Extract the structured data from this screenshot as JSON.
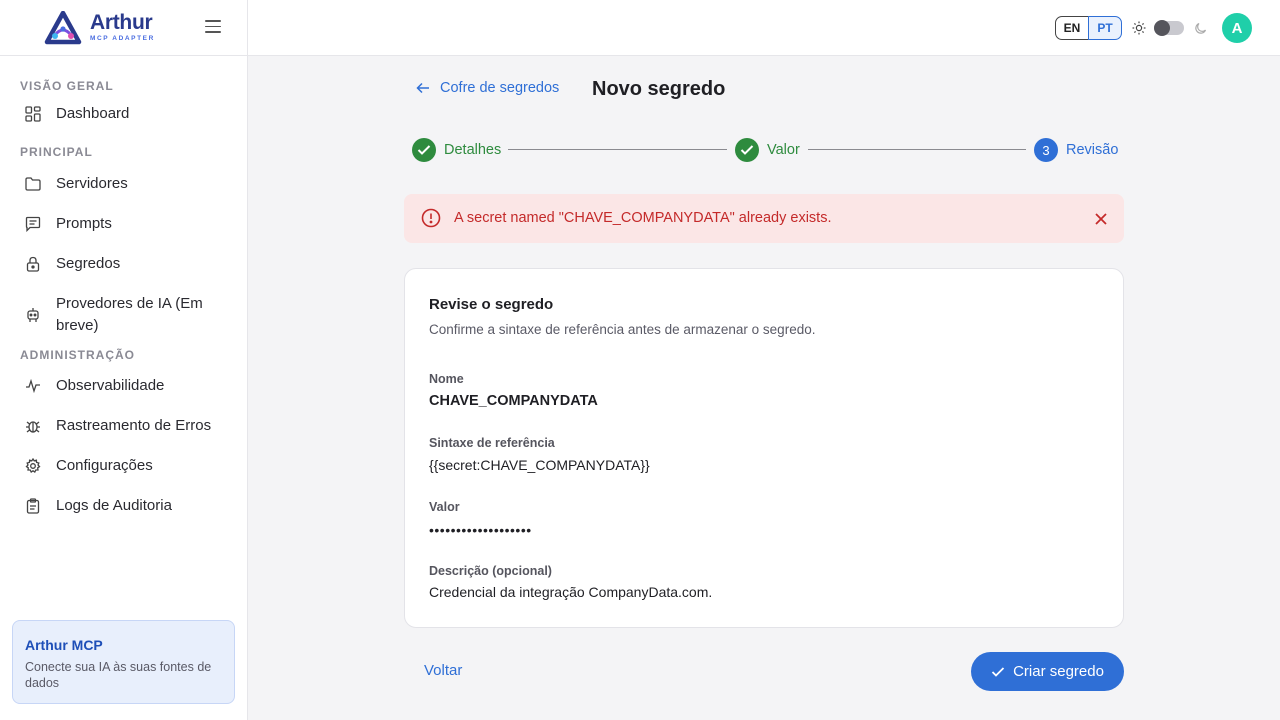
{
  "brand": {
    "name": "Arthur",
    "subtitle": "MCP ADAPTER"
  },
  "sidebar": {
    "sections": [
      {
        "title": "VISÃO GERAL",
        "items": [
          {
            "label": "Dashboard",
            "icon": "dashboard-grid-icon"
          }
        ]
      },
      {
        "title": "PRINCIPAL",
        "items": [
          {
            "label": "Servidores",
            "icon": "folder-icon"
          },
          {
            "label": "Prompts",
            "icon": "message-square-icon"
          },
          {
            "label": "Segredos",
            "icon": "lock-icon"
          },
          {
            "label": "Provedores de IA (Em breve)",
            "icon": "robot-icon"
          }
        ]
      },
      {
        "title": "ADMINISTRAÇÃO",
        "items": [
          {
            "label": "Observabilidade",
            "icon": "activity-pulse-icon"
          },
          {
            "label": "Rastreamento de Erros",
            "icon": "bug-icon"
          },
          {
            "label": "Configurações",
            "icon": "gear-icon"
          },
          {
            "label": "Logs de Auditoria",
            "icon": "clipboard-icon"
          }
        ]
      }
    ],
    "promo": {
      "title": "Arthur MCP",
      "text": "Conecte sua IA às suas fontes de dados"
    }
  },
  "topbar": {
    "languages": [
      "EN",
      "PT"
    ],
    "active_language": "PT",
    "avatar_initial": "A"
  },
  "header": {
    "back_label": "Cofre de segredos",
    "title": "Novo segredo"
  },
  "stepper": {
    "steps": [
      {
        "label": "Detalhes",
        "state": "done"
      },
      {
        "label": "Valor",
        "state": "done"
      },
      {
        "label": "Revisão",
        "state": "active",
        "number": "3"
      }
    ]
  },
  "alert": {
    "message": "A secret named \"CHAVE_COMPANYDATA\" already exists."
  },
  "review": {
    "title": "Revise o segredo",
    "subtitle": "Confirme a sintaxe de referência antes de armazenar o segredo.",
    "fields": [
      {
        "label": "Nome",
        "value": "CHAVE_COMPANYDATA"
      },
      {
        "label": "Sintaxe de referência",
        "value": "{{secret:CHAVE_COMPANYDATA}}"
      },
      {
        "label": "Valor",
        "value": "•••••••••••••••••••"
      },
      {
        "label": "Descrição (opcional)",
        "value": "Credencial da integração CompanyData.com."
      }
    ]
  },
  "actions": {
    "back_label": "Voltar",
    "create_label": "Criar segredo"
  },
  "colors": {
    "accent": "#2f6fd6",
    "success": "#2e8b3e",
    "error": "#c42a2a",
    "error_bg": "#fbe6e6",
    "avatar": "#1fcfa9"
  }
}
